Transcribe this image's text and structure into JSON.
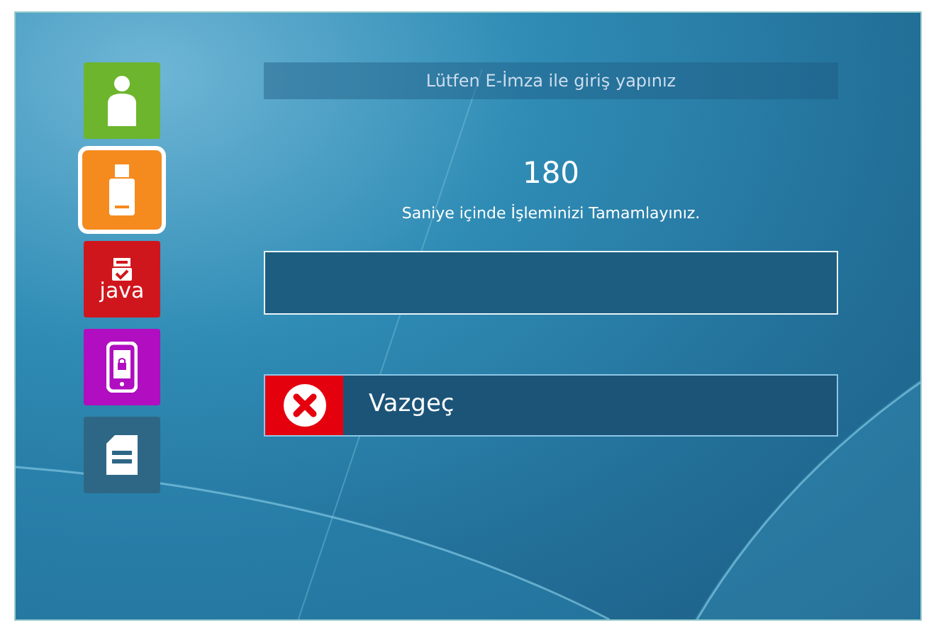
{
  "sidebar": {
    "items": [
      {
        "kind": "person",
        "color": "#6cb52d",
        "selected": false
      },
      {
        "kind": "usb",
        "color": "#f58a1f",
        "selected": true
      },
      {
        "kind": "java",
        "color": "#d0161d",
        "selected": false,
        "label": "java"
      },
      {
        "kind": "phone",
        "color": "#b00ec0",
        "selected": false
      },
      {
        "kind": "card",
        "color": "#2e6785",
        "selected": false
      }
    ]
  },
  "header": "Lütfen E-İmza ile giriş yapınız",
  "countdown": "180",
  "countdown_caption": "Saniye içinde İşleminizi Tamamlayınız.",
  "cancel_button": {
    "label": "Vazgeç"
  }
}
